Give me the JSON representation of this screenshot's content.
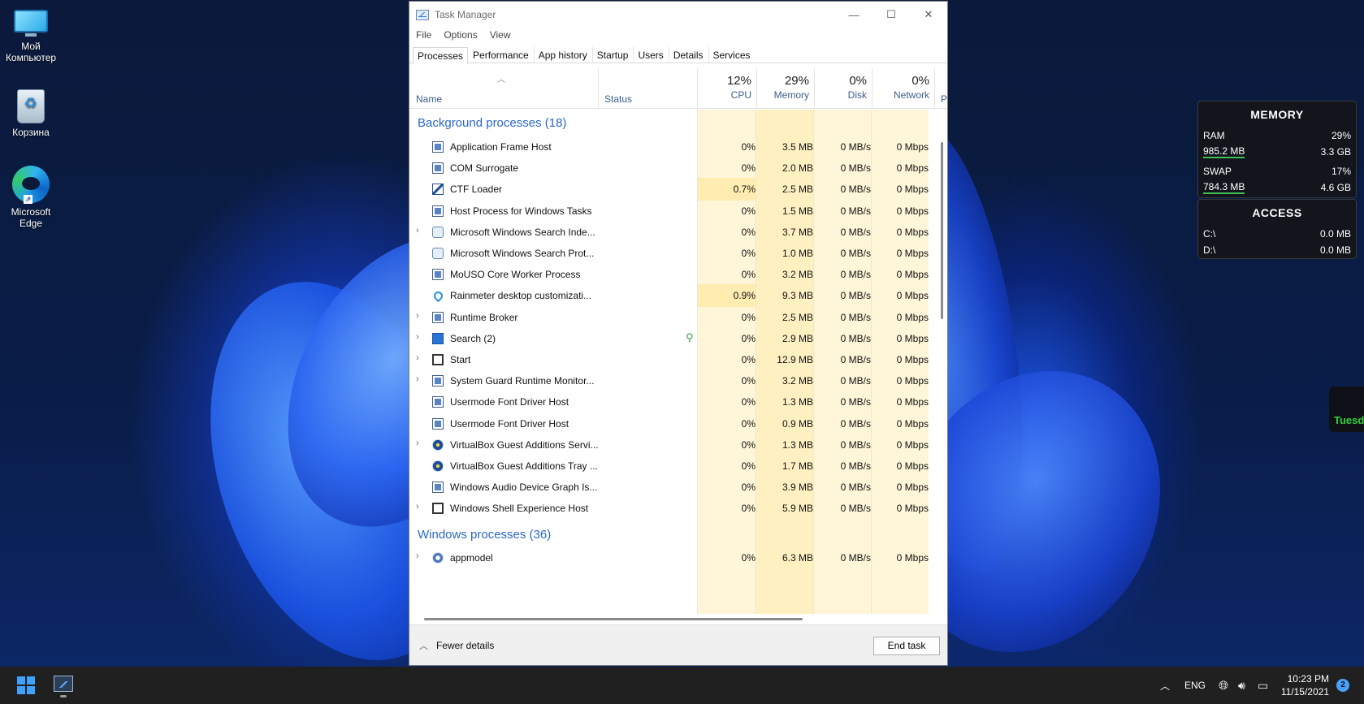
{
  "desktop": {
    "icons": [
      {
        "label_line1": "Мой",
        "label_line2": "Компьютер",
        "icon": "computer-icon"
      },
      {
        "label": "Корзина",
        "icon": "recycle-bin-icon"
      },
      {
        "label_line1": "Microsoft",
        "label_line2": "Edge",
        "icon": "edge-icon"
      }
    ]
  },
  "window": {
    "title": "Task Manager",
    "minimize": "—",
    "maximize": "☐",
    "close": "✕"
  },
  "menu": [
    "File",
    "Options",
    "View"
  ],
  "tabs": [
    "Processes",
    "Performance",
    "App history",
    "Startup",
    "Users",
    "Details",
    "Services"
  ],
  "active_tab": "Processes",
  "columns": {
    "name": "Name",
    "status": "Status",
    "cpu": {
      "pct": "12%",
      "label": "CPU"
    },
    "memory": {
      "pct": "29%",
      "label": "Memory"
    },
    "disk": {
      "pct": "0%",
      "label": "Disk"
    },
    "network": {
      "pct": "0%",
      "label": "Network"
    },
    "power": "Po"
  },
  "groups": {
    "background": "Background processes (18)",
    "windows": "Windows processes (36)"
  },
  "processes": [
    {
      "name": "Application Frame Host",
      "expandable": false,
      "icon": "app-window-icon",
      "cpu": "0%",
      "memory": "3.5 MB",
      "disk": "0 MB/s",
      "network": "0 Mbps"
    },
    {
      "name": "COM Surrogate",
      "expandable": false,
      "icon": "app-window-icon",
      "cpu": "0%",
      "memory": "2.0 MB",
      "disk": "0 MB/s",
      "network": "0 Mbps"
    },
    {
      "name": "CTF Loader",
      "expandable": false,
      "icon": "pen-icon",
      "cpu": "0.7%",
      "memory": "2.5 MB",
      "disk": "0 MB/s",
      "network": "0 Mbps"
    },
    {
      "name": "Host Process for Windows Tasks",
      "expandable": false,
      "icon": "app-window-icon",
      "cpu": "0%",
      "memory": "1.5 MB",
      "disk": "0 MB/s",
      "network": "0 Mbps"
    },
    {
      "name": "Microsoft Windows Search Inde...",
      "expandable": true,
      "icon": "search-indexer-icon",
      "cpu": "0%",
      "memory": "3.7 MB",
      "disk": "0 MB/s",
      "network": "0 Mbps"
    },
    {
      "name": "Microsoft Windows Search Prot...",
      "expandable": false,
      "icon": "search-indexer-icon",
      "cpu": "0%",
      "memory": "1.0 MB",
      "disk": "0 MB/s",
      "network": "0 Mbps"
    },
    {
      "name": "MoUSO Core Worker Process",
      "expandable": false,
      "icon": "app-window-icon",
      "cpu": "0%",
      "memory": "3.2 MB",
      "disk": "0 MB/s",
      "network": "0 Mbps"
    },
    {
      "name": "Rainmeter desktop customizati...",
      "expandable": false,
      "icon": "drop-icon",
      "cpu": "0.9%",
      "memory": "9.3 MB",
      "disk": "0 MB/s",
      "network": "0 Mbps"
    },
    {
      "name": "Runtime Broker",
      "expandable": true,
      "icon": "app-window-icon",
      "cpu": "0%",
      "memory": "2.5 MB",
      "disk": "0 MB/s",
      "network": "0 Mbps"
    },
    {
      "name": "Search (2)",
      "expandable": true,
      "icon": "search-app-icon",
      "suspended_leaf": true,
      "cpu": "0%",
      "memory": "2.9 MB",
      "disk": "0 MB/s",
      "network": "0 Mbps"
    },
    {
      "name": "Start",
      "expandable": true,
      "icon": "start-app-icon",
      "cpu": "0%",
      "memory": "12.9 MB",
      "disk": "0 MB/s",
      "network": "0 Mbps"
    },
    {
      "name": "System Guard Runtime Monitor...",
      "expandable": true,
      "icon": "app-window-icon",
      "cpu": "0%",
      "memory": "3.2 MB",
      "disk": "0 MB/s",
      "network": "0 Mbps"
    },
    {
      "name": "Usermode Font Driver Host",
      "expandable": false,
      "icon": "app-window-icon",
      "cpu": "0%",
      "memory": "1.3 MB",
      "disk": "0 MB/s",
      "network": "0 Mbps"
    },
    {
      "name": "Usermode Font Driver Host",
      "expandable": false,
      "icon": "app-window-icon",
      "cpu": "0%",
      "memory": "0.9 MB",
      "disk": "0 MB/s",
      "network": "0 Mbps"
    },
    {
      "name": "VirtualBox Guest Additions Servi...",
      "expandable": true,
      "icon": "virtualbox-icon",
      "cpu": "0%",
      "memory": "1.3 MB",
      "disk": "0 MB/s",
      "network": "0 Mbps"
    },
    {
      "name": "VirtualBox Guest Additions Tray ...",
      "expandable": false,
      "icon": "virtualbox-icon",
      "cpu": "0%",
      "memory": "1.7 MB",
      "disk": "0 MB/s",
      "network": "0 Mbps"
    },
    {
      "name": "Windows Audio Device Graph Is...",
      "expandable": false,
      "icon": "app-window-icon",
      "cpu": "0%",
      "memory": "3.9 MB",
      "disk": "0 MB/s",
      "network": "0 Mbps"
    },
    {
      "name": "Windows Shell Experience Host",
      "expandable": true,
      "icon": "start-app-icon",
      "cpu": "0%",
      "memory": "5.9 MB",
      "disk": "0 MB/s",
      "network": "0 Mbps"
    }
  ],
  "windows_processes": [
    {
      "name": "appmodel",
      "expandable": true,
      "icon": "gear-icon",
      "cpu": "0%",
      "memory": "6.3 MB",
      "disk": "0 MB/s",
      "network": "0 Mbps"
    }
  ],
  "footer": {
    "fewer_details": "Fewer details",
    "end_task": "End task"
  },
  "widgets": {
    "memory": {
      "title": "MEMORY",
      "ram_label": "RAM",
      "ram_pct": "29%",
      "ram_used": "985.2 MB",
      "ram_total": "3.3 GB",
      "swap_label": "SWAP",
      "swap_pct": "17%",
      "swap_used": "784.3 MB",
      "swap_total": "4.6 GB"
    },
    "access": {
      "title": "ACCESS",
      "c_label": "C:\\",
      "c_value": "0.0 MB",
      "d_label": "D:\\",
      "d_value": "0.0 MB"
    },
    "day_partial": "Tuesd"
  },
  "taskbar": {
    "language": "ENG",
    "time": "10:23 PM",
    "date": "11/15/2021",
    "notifications": "2",
    "accent": "#3ea2ff"
  }
}
